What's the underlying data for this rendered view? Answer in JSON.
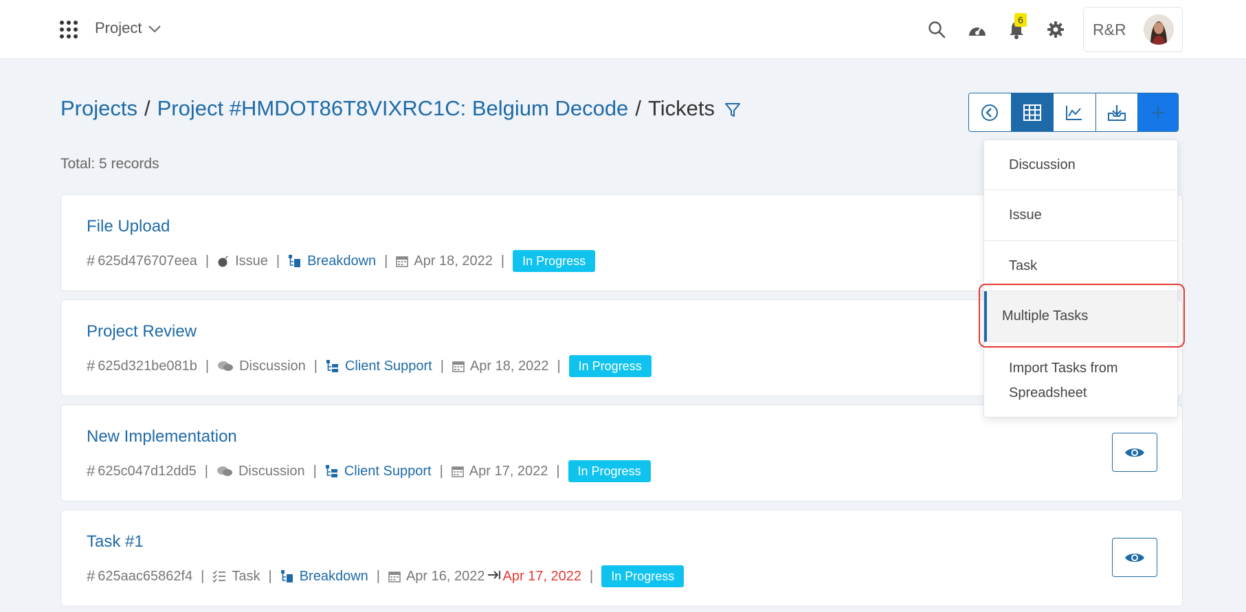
{
  "topbar": {
    "project_menu_label": "Project",
    "notifications_count": "6",
    "account_label": "R&R"
  },
  "breadcrumb": {
    "projects": "Projects",
    "separator": "/",
    "project": "Project #HMDOT86T8VIXRC1C: Belgium Decode",
    "current": "Tickets"
  },
  "summary": {
    "total_text": "Total: 5 records"
  },
  "add_menu": {
    "items": [
      "Discussion",
      "Issue",
      "Task",
      "Multiple Tasks"
    ],
    "import_line1": "Import Tasks from",
    "import_line2": "Spreadsheet"
  },
  "tickets": [
    {
      "title": "File Upload",
      "id": "625d476707eea",
      "type": "Issue",
      "category": "Breakdown",
      "date": "Apr 18, 2022",
      "status": "In Progress"
    },
    {
      "title": "Project Review",
      "id": "625d321be081b",
      "type": "Discussion",
      "category": "Client Support",
      "date": "Apr 18, 2022",
      "status": "In Progress"
    },
    {
      "title": "New Implementation",
      "id": "625c047d12dd5",
      "type": "Discussion",
      "category": "Client Support",
      "date": "Apr 17, 2022",
      "status": "In Progress"
    },
    {
      "title": "Task #1",
      "id": "625aac65862f4",
      "type": "Task",
      "category": "Breakdown",
      "date": "Apr 16, 2022",
      "due_date": "Apr 17, 2022",
      "status": "In Progress"
    }
  ],
  "colors": {
    "link": "#1e6aa8",
    "status": "#10c3ef",
    "overdue": "#e53935",
    "primary": "#1677e8"
  }
}
